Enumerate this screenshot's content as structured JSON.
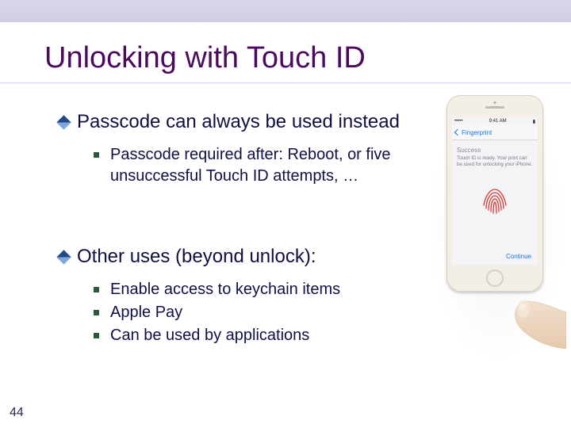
{
  "slide": {
    "title": "Unlocking with Touch ID",
    "page_number": "44"
  },
  "bullets": {
    "b1": {
      "text": "Passcode can always be used instead"
    },
    "b1_subs": {
      "s1": "Passcode required after: Reboot,  or five unsuccessful Touch ID attempts, …"
    },
    "b2": {
      "text": "Other uses  (beyond unlock):"
    },
    "b2_subs": {
      "s1": "Enable access to keychain items",
      "s2": "Apple Pay",
      "s3": "Can be used by applications"
    }
  },
  "phone": {
    "status_time": "9:41 AM",
    "nav_back": "Fingerprint",
    "heading": "Success",
    "desc": "Touch ID is ready. Your print can be used for unlocking your iPhone.",
    "continue": "Continue"
  }
}
